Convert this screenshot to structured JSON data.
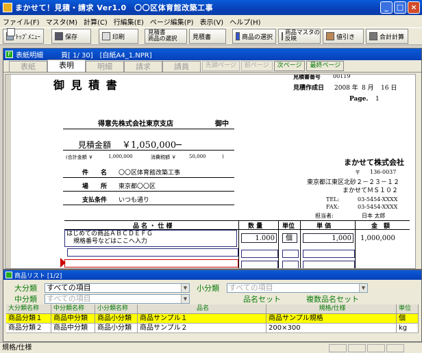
{
  "window": {
    "title": "まかせて！見積・請求 Ver1.0　〇〇区体育館改築工事"
  },
  "menu": [
    "ファイル(F)",
    "マスタ(M)",
    "計算(C)",
    "行編集(E)",
    "ページ編集(P)",
    "表示(V)",
    "ヘルプ(H)"
  ],
  "toolbar": {
    "top_menu": "ﾄｯﾌﾟﾒﾆｭｰ",
    "save": "保存",
    "print": "印刷",
    "select_estimate_1": "見積書",
    "select_estimate_2": "商品の選択",
    "estimate": "見積書",
    "select_goods": "商品の選択",
    "switch_1": "商品マスタの",
    "switch_2": "反映",
    "discount": "値引き",
    "total": "合計計算"
  },
  "sheet": {
    "title": "表紙明細",
    "page": "頁[ 1/ 30]",
    "paper": "[白紙A4_1.NPR]"
  },
  "tabs": [
    "表紙",
    "表明",
    "明細",
    "請求",
    "請員"
  ],
  "nav": [
    "先頭ページ",
    "前ページ",
    "次ページ",
    "最終ページ"
  ],
  "doc": {
    "heading": "御 見 積 書",
    "estimate_no_label": "見積書番号",
    "estimate_no": "00119",
    "created_label": "見積作成日",
    "created_year": "2008 年",
    "created_month": "8 月",
    "created_day": "16 日",
    "page_label": "Page.",
    "page_no": "1",
    "client": "得意先株式会社東京支店",
    "client_suffix": "御中",
    "amount_label": "見積金額",
    "amount": "￥1,050,000─",
    "subtotal_label": "(合計金額 ￥",
    "subtotal": "1,000,000",
    "tax_label": "消費税額 ￥",
    "tax": "50,000",
    "close_paren": ")",
    "item_label": "件　　名",
    "item_value": "〇〇区体育館改築工事",
    "place_label": "場　　所",
    "place_value": "東京都〇〇区",
    "terms_label": "支払条件",
    "terms_value": "いつも通り",
    "company": "まかせて株式会社",
    "zip_mark": "〒",
    "zip": "136-0037",
    "address": "東京都江東区北砂２－２３－１２",
    "building": "まかせてＭＳ１０２",
    "tel_label": "TEL:",
    "tel": "03-5454-XXXX",
    "fax_label": "FAX:",
    "fax": "03-5454-XXXX",
    "person_label": "担当者:",
    "person": "日本 太郎",
    "col_name": "品 名 ・ 仕 様",
    "col_qty": "数 量",
    "col_unit": "単位",
    "col_price": "単 価",
    "col_amount": "金　額",
    "row1_name": "はじめての商品ＡＢＣＤＥＦＧ",
    "row1_spec": "規格番号などはここへ入力",
    "row1_qty": "1.000",
    "row1_unit": "個",
    "row1_price": "1,000",
    "row1_amount": "1,000,000"
  },
  "list": {
    "title": "商品リスト [1/2]",
    "major_label": "大分類",
    "major_value": "すべての項目",
    "minor_label": "小分類",
    "minor_value": "すべての項目",
    "middle_label": "中分類",
    "middle_value": "すべての項目",
    "name_set": "品名セット",
    "multi_set": "複数品名セット",
    "headers": [
      "大分類名称",
      "中分類名称",
      "小分類名称",
      "品名",
      "規格/仕様",
      "単位"
    ],
    "rows": [
      [
        "商品分類１",
        "商品中分類",
        "商品小分類",
        "商品サンプル１",
        "商品サンプル規格",
        "個"
      ],
      [
        "商品分類２",
        "商品中分類",
        "商品小分類",
        "商品サンプル２",
        "200×300",
        "kg"
      ]
    ]
  },
  "status": {
    "text": "規格/仕様"
  }
}
